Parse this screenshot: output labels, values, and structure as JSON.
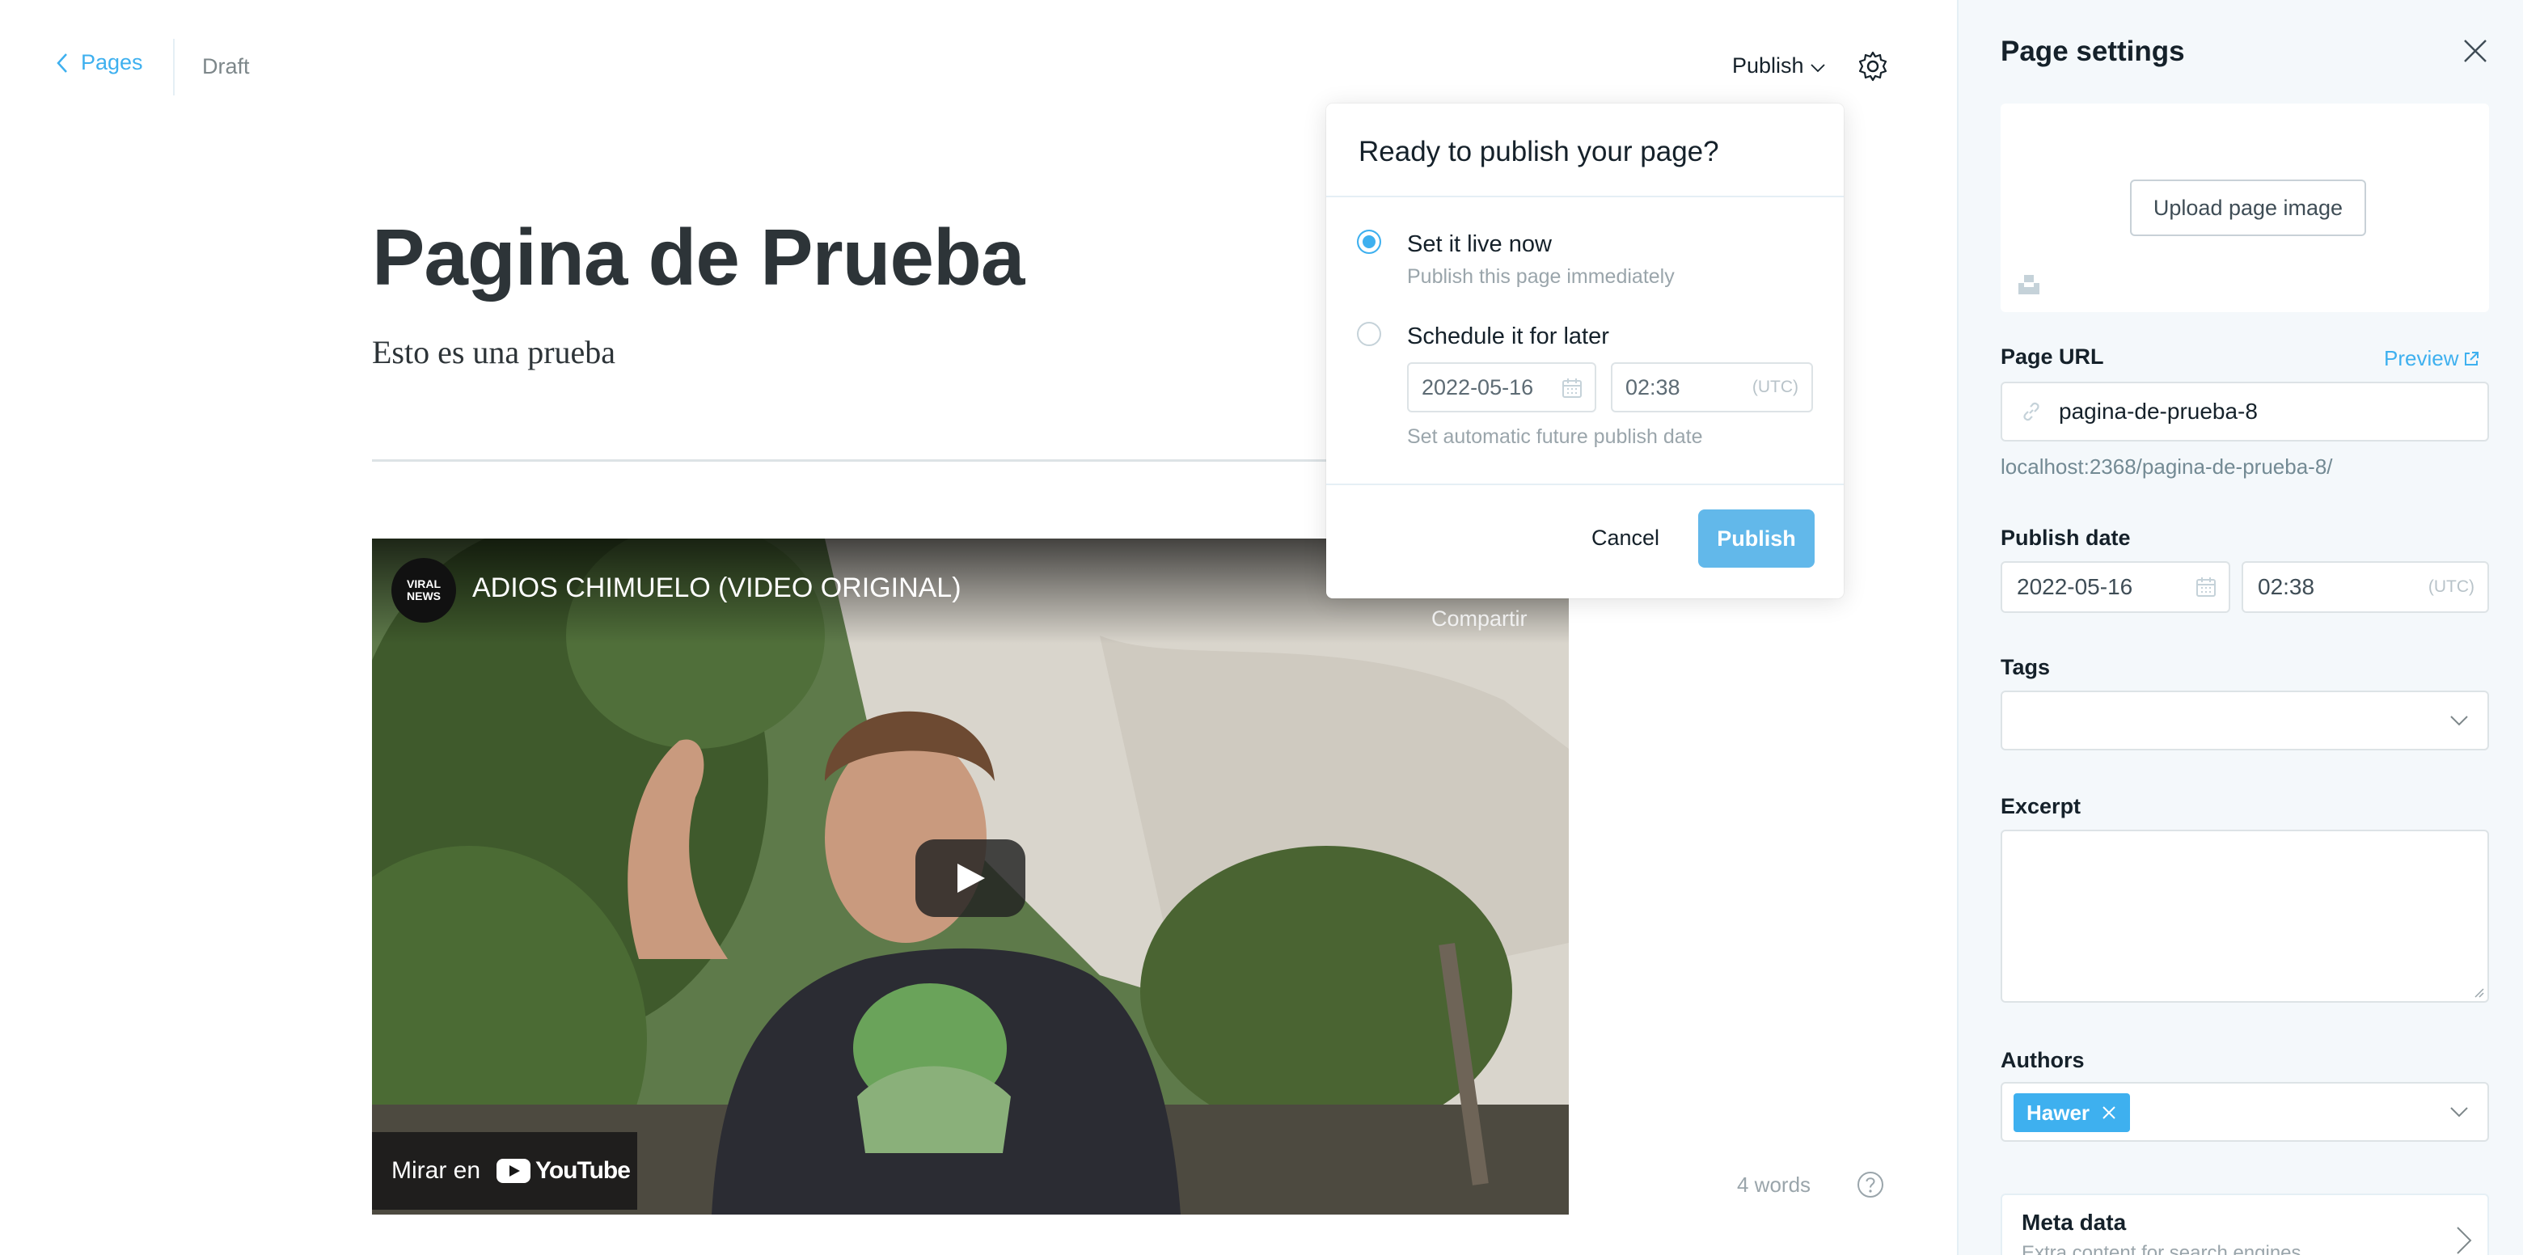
{
  "header": {
    "back_label": "Pages",
    "status": "Draft",
    "publish_label": "Publish"
  },
  "editor": {
    "title": "Pagina de Prueba",
    "subtitle": "Esto es una prueba",
    "word_count": "4 words"
  },
  "video": {
    "channel_badge": "VIRAL NEWS",
    "title": "ADIOS CHIMUELO (VIDEO ORIGINAL)",
    "share_label": "Compartir",
    "watch_on": "Mirar en",
    "brand": "YouTube"
  },
  "publish_popover": {
    "title": "Ready to publish your page?",
    "option_now": {
      "label": "Set it live now",
      "description": "Publish this page immediately",
      "selected": true
    },
    "option_later": {
      "label": "Schedule it for later",
      "description": "Set automatic future publish date",
      "selected": false
    },
    "date": "2022-05-16",
    "time": "02:38",
    "timezone": "(UTC)",
    "cancel_label": "Cancel",
    "publish_label": "Publish"
  },
  "settings": {
    "title": "Page settings",
    "upload_label": "Upload page image",
    "url_label": "Page URL",
    "preview_label": "Preview",
    "url_value": "pagina-de-prueba-8",
    "url_full": "localhost:2368/pagina-de-prueba-8/",
    "publish_date_label": "Publish date",
    "publish_date": "2022-05-16",
    "publish_time": "02:38",
    "timezone": "(UTC)",
    "tags_label": "Tags",
    "excerpt_label": "Excerpt",
    "authors_label": "Authors",
    "authors": [
      "Hawer"
    ],
    "meta_title": "Meta data",
    "meta_desc": "Extra content for search engines"
  },
  "colors": {
    "accent": "#3eb0ef",
    "publish_button": "#62b8ea",
    "sidebar_bg": "#f4f8fb"
  }
}
